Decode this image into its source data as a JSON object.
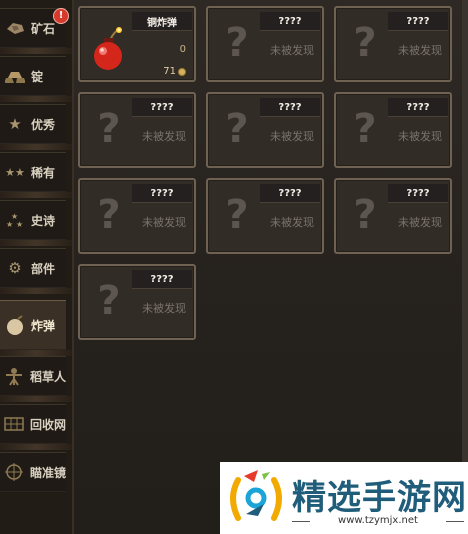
{
  "sidebar": {
    "badge": "!",
    "items": [
      {
        "label": "矿石",
        "icon": "ore-icon"
      },
      {
        "label": "锭",
        "icon": "ingot-icon"
      },
      {
        "label": "优秀",
        "icon": "star-icon"
      },
      {
        "label": "稀有",
        "icon": "double-star-icon"
      },
      {
        "label": "史诗",
        "icon": "triple-star-icon"
      },
      {
        "label": "部件",
        "icon": "gear-icon"
      },
      {
        "label": "炸弹",
        "icon": "bomb-icon"
      },
      {
        "label": "稻草人",
        "icon": "scarecrow-icon"
      },
      {
        "label": "回收网",
        "icon": "net-icon"
      },
      {
        "label": "瞄准镜",
        "icon": "scope-icon"
      }
    ],
    "active_index": 6
  },
  "grid": {
    "known": {
      "name": "铜炸弹",
      "quantity": "0",
      "price": "71"
    },
    "unknown_name": "????",
    "unknown_status": "未被发现",
    "count": 10
  },
  "watermark": {
    "title": "精选手游网",
    "url": "www.tzymjx.net"
  },
  "colors": {
    "card_border": "#6f6253",
    "card_bg": "#322c27",
    "sidebar_bg": "#221c17",
    "bomb_red": "#d4261b"
  }
}
